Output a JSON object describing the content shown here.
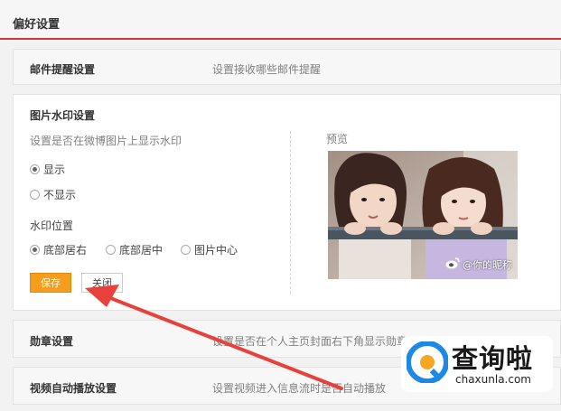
{
  "page": {
    "title": "偏好设置"
  },
  "mail": {
    "label": "邮件提醒设置",
    "desc": "设置接收哪些邮件提醒"
  },
  "watermark": {
    "title": "图片水印设置",
    "desc": "设置是否在微博图片上显示水印",
    "options": [
      {
        "label": "显示",
        "checked": true
      },
      {
        "label": "不显示",
        "checked": false
      }
    ],
    "position_label": "水印位置",
    "positions": [
      {
        "label": "底部居右",
        "checked": true
      },
      {
        "label": "底部居中",
        "checked": false
      },
      {
        "label": "图片中心",
        "checked": false
      }
    ],
    "save_label": "保存",
    "close_label": "关闭",
    "preview_label": "预览",
    "preview_watermark": "@你的昵称"
  },
  "medal": {
    "label": "勋章设置",
    "desc": "设置是否在个人主页封面右下角显示勋章"
  },
  "video": {
    "label": "视频自动播放设置",
    "desc": "设置视频进入信息流时是否自动播放"
  },
  "logo": {
    "main": "查询啦",
    "sub": "chaxunla.com"
  },
  "colors": {
    "accent": "#d3323a",
    "save_button": "#f59d1c",
    "arrow": "#e8403a",
    "logo_blue": "#1e88e5"
  }
}
